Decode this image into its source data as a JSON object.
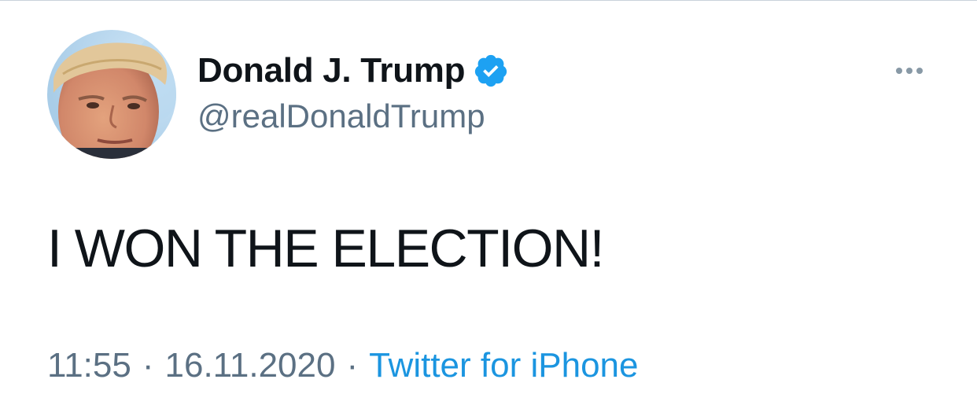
{
  "tweet": {
    "author": {
      "display_name": "Donald J. Trump",
      "handle": "@realDonaldTrump",
      "verified": true,
      "verified_icon": "verified-badge-icon",
      "avatar": "profile-photo"
    },
    "text": "I WON THE ELECTION!",
    "time": "11:55",
    "date": "16.11.2020",
    "separator": "·",
    "source": "Twitter for iPhone",
    "more_icon": "more-options-icon"
  },
  "colors": {
    "primary_text": "#0f1419",
    "secondary_text": "#5b7083",
    "link": "#1b95e0",
    "verified": "#1da1f2"
  }
}
